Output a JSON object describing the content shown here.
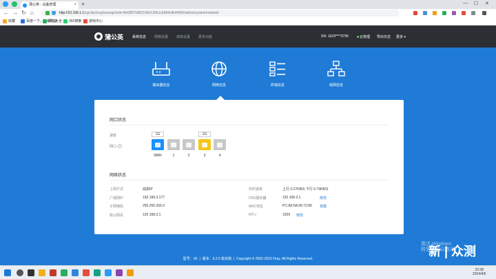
{
  "browser": {
    "tab_title": "蒲公英 - 设备管理",
    "tab_close": "×",
    "new_tab": "+",
    "url_host": "http://10.168.1.1",
    "url_path": "/cgi-bin/orayboxmgr/stok=9e68970d62199e130b1cb584c8b4460f/admin/system/network",
    "window_min": "—",
    "window_max": "☐",
    "window_close": "✕",
    "back": "←",
    "forward": "→",
    "reload": "↻",
    "home": "⌂",
    "bookmarks": [
      "收藏",
      "百度一下，你就知道",
      "网址大全",
      "360搜索",
      "游戏中心"
    ]
  },
  "app": {
    "logo_text": "蒲公英",
    "nav": [
      "系统信息",
      "网络设置",
      "高级设置",
      "更多功能"
    ],
    "sn_label": "SN:",
    "sn_value": "1629****3799",
    "cloud_status": "云管理",
    "logout": "导出日志",
    "more": "更多 ▾"
  },
  "categories": [
    {
      "label": "路由器信息",
      "icon": "router-icon"
    },
    {
      "label": "网络信息",
      "icon": "globe-icon"
    },
    {
      "label": "终端信息",
      "icon": "device-list-icon"
    },
    {
      "label": "组网信息",
      "icon": "network-topology-icon"
    }
  ],
  "port_status": {
    "title": "网口状态",
    "speed_label": "速度",
    "port_label": "网口",
    "help": "?",
    "speeds": [
      "1G",
      "",
      "",
      "1G",
      ""
    ],
    "ports": [
      {
        "name": "WAN",
        "state": "wan-active",
        "color": "#1890ff"
      },
      {
        "name": "1",
        "state": "idle",
        "color": "#c8c8c8"
      },
      {
        "name": "2",
        "state": "idle",
        "color": "#c8c8c8"
      },
      {
        "name": "3",
        "state": "lan-active",
        "color": "#f5c518"
      },
      {
        "name": "4",
        "state": "idle",
        "color": "#c8c8c8"
      }
    ]
  },
  "network_status": {
    "title": "网络状态",
    "left": [
      {
        "label": "上网方式",
        "value": "动态IP"
      },
      {
        "label": "广域网IP",
        "value": "192.168.3.177"
      },
      {
        "label": "子网掩码",
        "value": "255.255.255.0"
      },
      {
        "label": "默认网关",
        "value": "192.168.3.1"
      }
    ],
    "right": [
      {
        "label": "实时速率",
        "value": "上行 0.27KB/S  下行 0.79KB/S",
        "link": ""
      },
      {
        "label": "DNS服务器",
        "value": "192.168.3.1",
        "link": "修改"
      },
      {
        "label": "MAC地址",
        "value": "PC:A0:5A:06:72:89",
        "link": "克隆"
      },
      {
        "label": "MTU",
        "value": "1500",
        "link": "修改"
      }
    ]
  },
  "footer": {
    "model": "型号：X5",
    "version": "版本：6.2.0 稳定版",
    "copyright": "Copyright © 2002-2022 Oray. All Rights Reserved."
  },
  "watermark": {
    "activate_title": "激活 Windows",
    "activate_sub": "转到设置以激活",
    "brand": "新 | 众测"
  },
  "taskbar": {
    "time": "22:38",
    "date": "2024/4/6"
  },
  "colors": {
    "primary": "#1f7bd6",
    "header": "#2b2f33",
    "wan_port": "#1890ff",
    "lan_active": "#f5c518"
  }
}
